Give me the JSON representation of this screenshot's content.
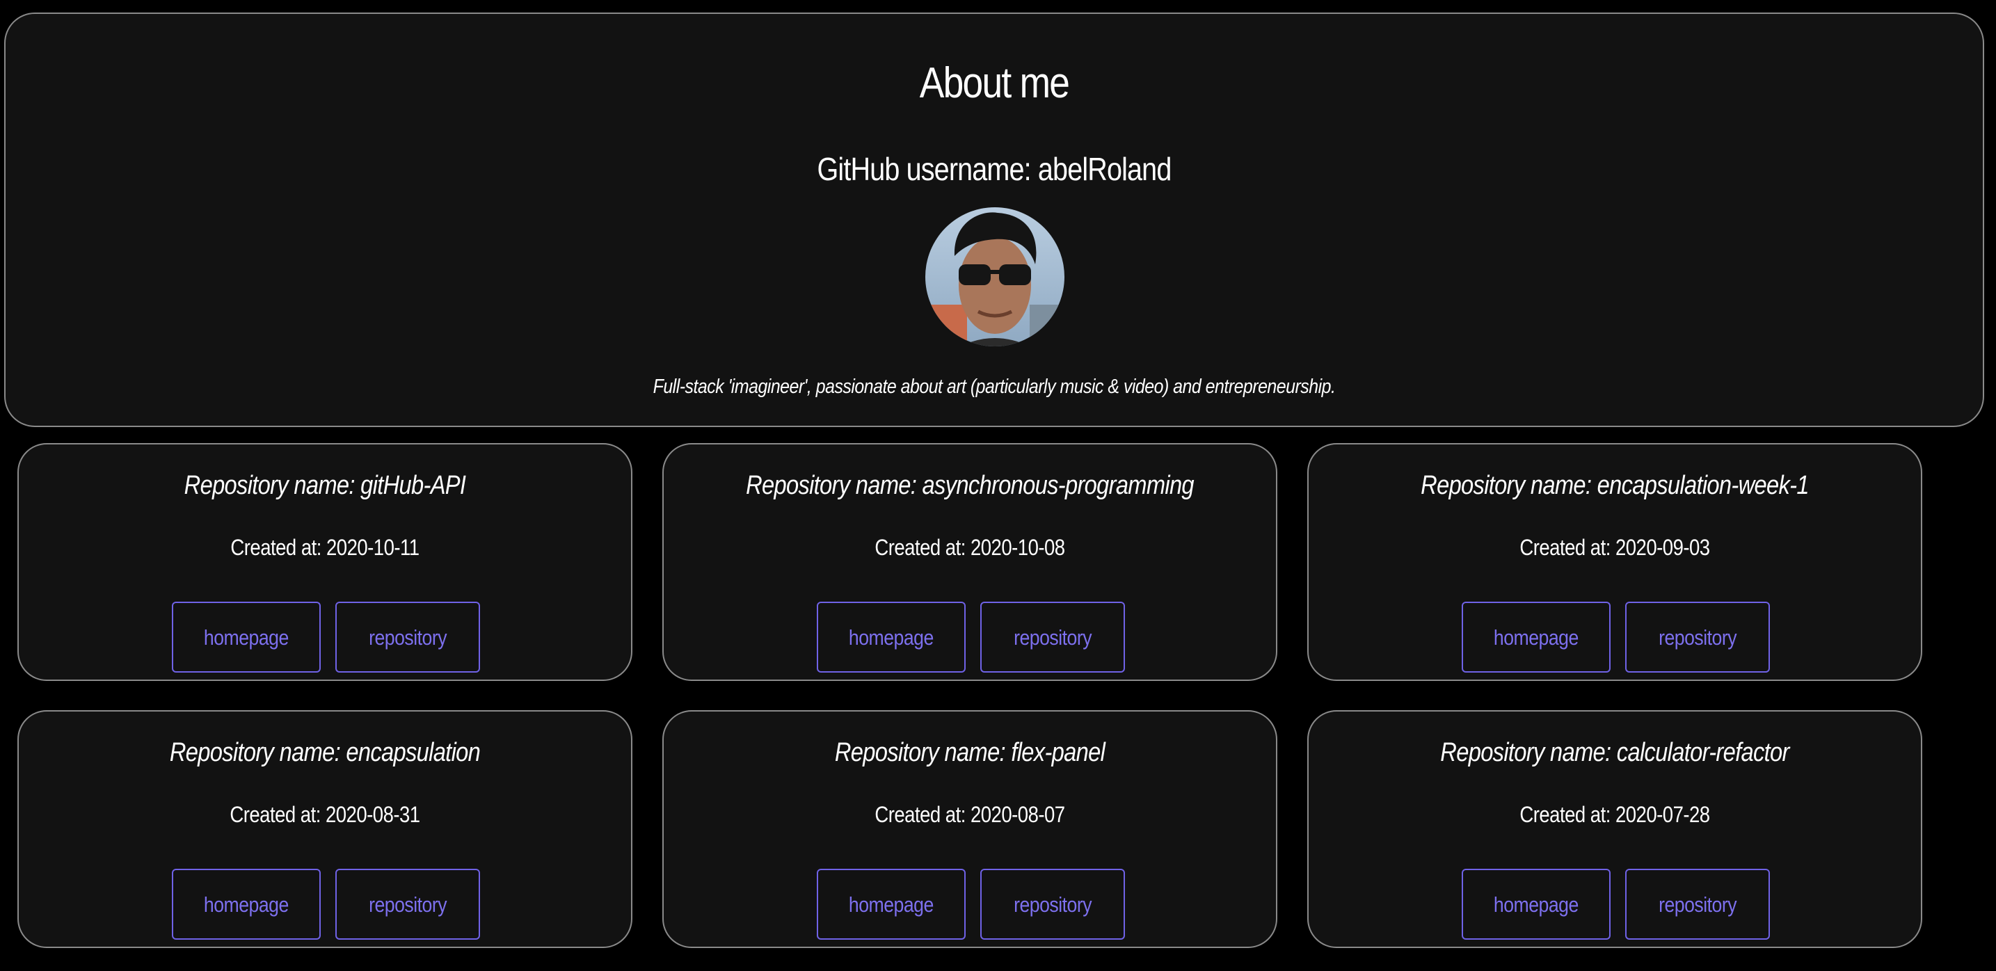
{
  "about": {
    "title": "About me",
    "username_line": "GitHub username: abelRoland",
    "bio": "Full-stack 'imagineer', passionate about art (particularly music & video) and entrepreneurship."
  },
  "repos": [
    {
      "name": "Repository name: gitHub-API",
      "created": "Created at: 2020-10-11",
      "homepage_label": "homepage",
      "repository_label": "repository"
    },
    {
      "name": "Repository name: asynchronous-programming",
      "created": "Created at: 2020-10-08",
      "homepage_label": "homepage",
      "repository_label": "repository"
    },
    {
      "name": "Repository name: encapsulation-week-1",
      "created": "Created at: 2020-09-03",
      "homepage_label": "homepage",
      "repository_label": "repository"
    },
    {
      "name": "Repository name: encapsulation",
      "created": "Created at: 2020-08-31",
      "homepage_label": "homepage",
      "repository_label": "repository"
    },
    {
      "name": "Repository name: flex-panel",
      "created": "Created at: 2020-08-07",
      "homepage_label": "homepage",
      "repository_label": "repository"
    },
    {
      "name": "Repository name: calculator-refactor",
      "created": "Created at: 2020-07-28",
      "homepage_label": "homepage",
      "repository_label": "repository"
    }
  ],
  "colors": {
    "background": "#000000",
    "card": "#121212",
    "border": "#8a8a8a",
    "accent": "#6f62e6",
    "text": "#ffffff"
  },
  "icons": {
    "avatar": "profile-photo"
  }
}
